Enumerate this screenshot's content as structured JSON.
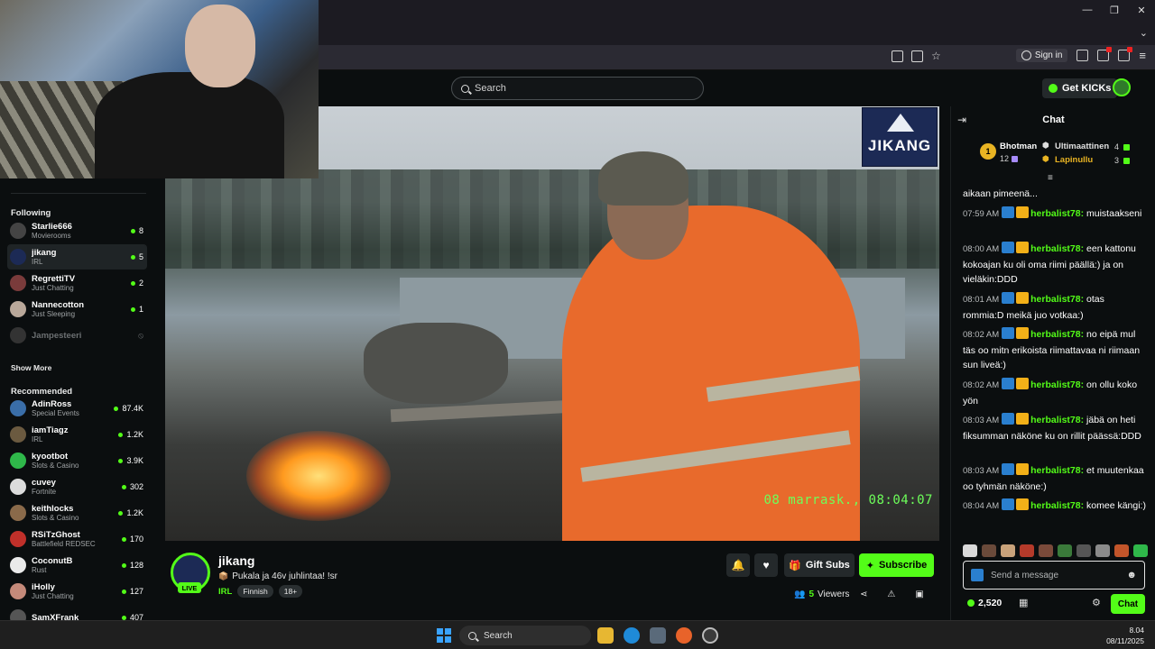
{
  "browser": {
    "signin_label": "Sign in",
    "window_controls": [
      "minimize-icon",
      "restore-icon",
      "close-icon"
    ]
  },
  "header": {
    "search_placeholder": "Search",
    "get_kicks_label": "Get KICKs"
  },
  "sidebar": {
    "following_heading": "Following",
    "following": [
      {
        "name": "Starlie666",
        "category": "Movierooms",
        "viewers": "8",
        "color": "#444"
      },
      {
        "name": "jikang",
        "category": "IRL",
        "viewers": "5",
        "color": "#1c2a55",
        "active": true
      },
      {
        "name": "RegrettiTV",
        "category": "Just Chatting",
        "viewers": "2",
        "color": "#7a3b3b"
      },
      {
        "name": "Nannecotton",
        "category": "Just Sleeping",
        "viewers": "1",
        "color": "#b9a89a"
      },
      {
        "name": "Jampesteeri",
        "category": "",
        "viewers": "",
        "color": "#333",
        "offline": true
      }
    ],
    "show_more_label": "Show More",
    "recommended_heading": "Recommended",
    "recommended": [
      {
        "name": "AdinRoss",
        "category": "Special Events",
        "viewers": "87.4K",
        "color": "#3a6ea8"
      },
      {
        "name": "iamTiagz",
        "category": "IRL",
        "viewers": "1.2K",
        "color": "#6b5a40"
      },
      {
        "name": "kyootbot",
        "category": "Slots & Casino",
        "viewers": "3.9K",
        "color": "#2fb84a"
      },
      {
        "name": "cuvey",
        "category": "Fortnite",
        "viewers": "302",
        "color": "#dcdcdc"
      },
      {
        "name": "keithlocks",
        "category": "Slots & Casino",
        "viewers": "1.2K",
        "color": "#8a6a4a"
      },
      {
        "name": "RSiTzGhost",
        "category": "Battlefield REDSEC",
        "viewers": "170",
        "color": "#c0302a"
      },
      {
        "name": "CoconutB",
        "category": "Rust",
        "viewers": "128",
        "color": "#eaeaea"
      },
      {
        "name": "iHolly",
        "category": "Just Chatting",
        "viewers": "127",
        "color": "#c58a7a"
      },
      {
        "name": "SamXFrank",
        "category": "",
        "viewers": "407",
        "color": "#555"
      }
    ]
  },
  "video": {
    "timestamp": "08 marrask., 08:04:07",
    "channel_logo_text": "JIKANG"
  },
  "stream": {
    "channel_name": "jikang",
    "live_label": "LIVE",
    "title": "Pukala ja 46v juhlintaa! !sr",
    "category": "IRL",
    "tags": [
      "Finnish",
      "18+"
    ],
    "gift_subs_label": "Gift Subs",
    "subscribe_label": "Subscribe",
    "viewers_count": "5",
    "viewers_label": "Viewers"
  },
  "chat": {
    "title": "Chat",
    "pinned": {
      "rank1_badge": "1",
      "rank1_user": "Bhotman",
      "rank1_count": "12",
      "rank2_user": "Ultimaattinen",
      "rank2_count": "4",
      "rank3_user": "Lapinullu",
      "rank3_count": "3"
    },
    "partial_message": "aikaan pimeenä...",
    "messages": [
      {
        "time": "07:59 AM",
        "user": "herbalist78",
        "text": "muistaakseni"
      },
      {
        "time": "08:00 AM",
        "user": "herbalist78",
        "text": "een kattonu kokoajan ku oli oma riimi päällä:) ja on vieläkin:DDD"
      },
      {
        "time": "08:01 AM",
        "user": "herbalist78",
        "text": "otas rommia:D meikä juo votkaa:)"
      },
      {
        "time": "08:02 AM",
        "user": "herbalist78",
        "text": "no eipä mul täs oo mitn erikoista riimattavaa ni riimaan sun liveä:)"
      },
      {
        "time": "08:02 AM",
        "user": "herbalist78",
        "text": "on ollu koko yön"
      },
      {
        "time": "08:03 AM",
        "user": "herbalist78",
        "text": "jäbä on heti fiksumman näköne ku on rillit päässä:DDD"
      },
      {
        "time": "08:03 AM",
        "user": "herbalist78",
        "text": "et muutenkaa oo tyhmän näköne:)"
      },
      {
        "time": "08:04 AM",
        "user": "herbalist78",
        "text": "komee kängi:)"
      }
    ],
    "input_placeholder": "Send a message",
    "kicks_balance": "2,520",
    "send_label": "Chat",
    "emote_colors": [
      "#d9d9d9",
      "#6a4a3a",
      "#c9a27a",
      "#b53a2a",
      "#7a4a3a",
      "#3a7a3a",
      "#555",
      "#8a8a8a",
      "#c2552a",
      "#2fb84a"
    ]
  },
  "taskbar": {
    "search_label": "Search",
    "time": "8.04",
    "date": "08/11/2025"
  },
  "colors": {
    "kick_green": "#53fc18",
    "background": "#0b0e0f"
  }
}
